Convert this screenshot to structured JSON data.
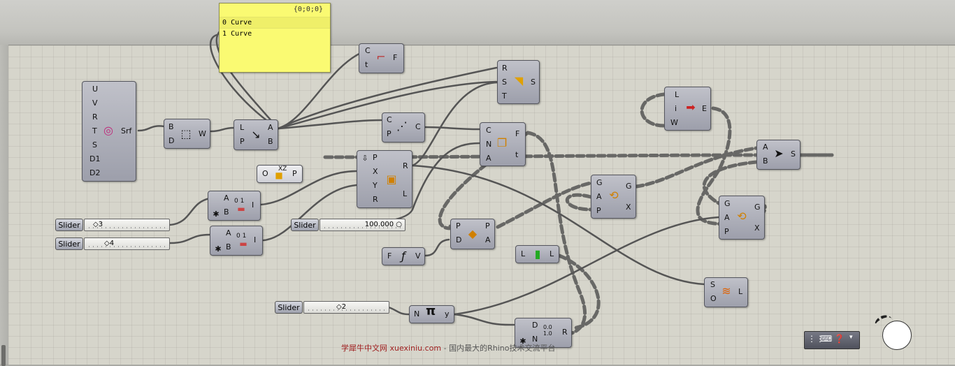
{
  "panel": {
    "header": "{0;0;0}",
    "rows": [
      {
        "idx": "0",
        "val": "Curve"
      },
      {
        "idx": "1",
        "val": "Curve"
      }
    ]
  },
  "components": {
    "surface": {
      "inputs": [
        "U",
        "V",
        "R",
        "T",
        "S",
        "D1",
        "D2"
      ],
      "outputs": [
        "Srf"
      ],
      "icon": "torus-icon"
    },
    "box": {
      "inputs": [
        "B",
        "D"
      ],
      "outputs": [
        "W"
      ],
      "icon": "box-icon"
    },
    "divide": {
      "inputs": [
        "L",
        "P"
      ],
      "outputs": [
        "A",
        "B"
      ],
      "icon": "split-arrow-icon"
    },
    "eval_curve": {
      "inputs": [
        "C",
        "t"
      ],
      "outputs": [
        "F"
      ],
      "icon": "curve-frame-icon"
    },
    "sweep": {
      "inputs": [
        "R",
        "S",
        "T"
      ],
      "outputs": [
        "S"
      ],
      "icon": "sweep-icon"
    },
    "closest": {
      "inputs": [
        "C",
        "P"
      ],
      "outputs": [
        "C"
      ],
      "icon": "closest-icon"
    },
    "offset": {
      "inputs": [
        "C",
        "N",
        "A"
      ],
      "outputs": [
        "F",
        "t"
      ],
      "icon": "offset-icon"
    },
    "graph": {
      "inputs": [
        "P",
        "X",
        "Y",
        "R"
      ],
      "outputs": [
        "R",
        "L"
      ],
      "icon": "graph-icon"
    },
    "xz": {
      "inputs": [
        "O"
      ],
      "outputs": [
        "P"
      ],
      "icon": "xz-plane-icon",
      "label": "XZ"
    },
    "range1": {
      "inputs": [
        "A",
        "B"
      ],
      "outputs": [
        "I"
      ],
      "icon": "range-icon",
      "label": "0 1"
    },
    "range2": {
      "inputs": [
        "A",
        "B"
      ],
      "outputs": [
        "I"
      ],
      "icon": "range-icon",
      "label": "0 1"
    },
    "line_fn": {
      "inputs": [
        "F"
      ],
      "outputs": [
        "V"
      ],
      "icon": "function-icon"
    },
    "project": {
      "inputs": [
        "P",
        "D"
      ],
      "outputs": [
        "P",
        "A"
      ],
      "icon": "project-icon"
    },
    "length": {
      "inputs": [
        "L"
      ],
      "outputs": [
        "L"
      ],
      "icon": "length-icon"
    },
    "rotate1": {
      "inputs": [
        "G",
        "A",
        "P"
      ],
      "outputs": [
        "G",
        "X"
      ],
      "icon": "rotate-icon"
    },
    "rotate2": {
      "inputs": [
        "G",
        "A",
        "P"
      ],
      "outputs": [
        "G",
        "X"
      ],
      "icon": "rotate-icon"
    },
    "extend": {
      "inputs": [
        "L",
        "i",
        "W"
      ],
      "outputs": [
        "E"
      ],
      "icon": "extend-icon"
    },
    "merge": {
      "inputs": [
        "A",
        "B"
      ],
      "outputs": [
        "S"
      ],
      "icon": "merge-icon"
    },
    "loft": {
      "inputs": [
        "S",
        "O"
      ],
      "outputs": [
        "L"
      ],
      "icon": "loft-icon"
    },
    "pi": {
      "inputs": [
        "N"
      ],
      "outputs": [
        "y"
      ],
      "icon": "pi-icon",
      "label": "π"
    },
    "decimal": {
      "inputs": [
        "D",
        "N"
      ],
      "outputs": [
        "R"
      ],
      "icon": "decimal-icon",
      "label": "0.0 1.0"
    }
  },
  "sliders": [
    {
      "label": "Slider",
      "value": "◇3"
    },
    {
      "label": "Slider",
      "value": "◇4"
    },
    {
      "label": "Slider",
      "value": "100.000 ○"
    },
    {
      "label": "Slider",
      "value": "◇2"
    }
  ],
  "watermark": {
    "brand": "学犀牛中文网 xuexiniu.com",
    "tagline": "- 国内最大的Rhino技术交流平台"
  },
  "toolbar": {
    "icons": [
      "grid-icon",
      "keyboard-icon",
      "help-icon",
      "dropdown-icon"
    ]
  }
}
